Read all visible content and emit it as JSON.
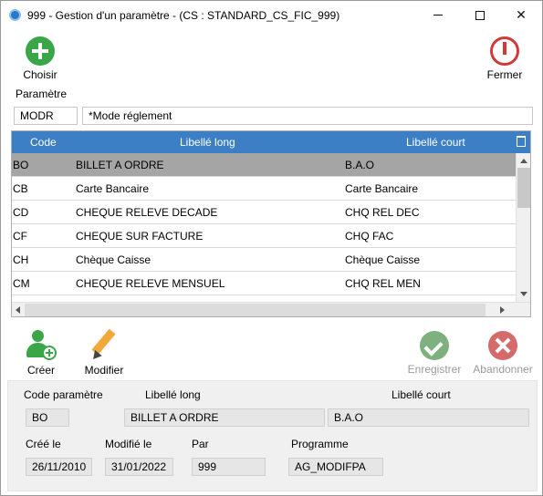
{
  "window": {
    "title": "999 - Gestion d'un paramètre - (CS : STANDARD_CS_FIC_999)",
    "controls": {
      "minimize": "—",
      "maximize": "☐",
      "close": "✕"
    }
  },
  "toolbar": {
    "choose_label": "Choisir",
    "close_label": "Fermer"
  },
  "parameter": {
    "section_label": "Paramètre",
    "code": "MODR",
    "label": "*Mode réglement"
  },
  "grid": {
    "columns": [
      "Code",
      "Libellé long",
      "Libellé court"
    ],
    "rows": [
      {
        "code": "BO",
        "long": "BILLET A ORDRE",
        "short": "B.A.O"
      },
      {
        "code": "CB",
        "long": "Carte Bancaire",
        "short": "Carte Bancaire"
      },
      {
        "code": "CD",
        "long": "CHEQUE RELEVE DECADE",
        "short": "CHQ REL DEC"
      },
      {
        "code": "CF",
        "long": "CHEQUE SUR FACTURE",
        "short": "CHQ FAC"
      },
      {
        "code": "CH",
        "long": "Chèque Caisse",
        "short": "Chèque Caisse"
      },
      {
        "code": "CM",
        "long": "CHEQUE RELEVE MENSUEL",
        "short": "CHQ REL MEN"
      }
    ],
    "selected_index": 0
  },
  "actions": {
    "create_label": "Créer",
    "modify_label": "Modifier",
    "save_label": "Enregistrer",
    "cancel_label": "Abandonner"
  },
  "detail": {
    "code_label": "Code paramètre",
    "long_label": "Libellé long",
    "short_label": "Libellé court",
    "code_value": "BO",
    "long_value": "BILLET A ORDRE",
    "short_value": "B.A.O",
    "created_label": "Créé le",
    "modified_label": "Modifié le",
    "by_label": "Par",
    "program_label": "Programme",
    "created_value": "26/11/2010",
    "modified_value": "31/01/2022",
    "by_value": "999",
    "program_value": "AG_MODIFPA"
  },
  "colors": {
    "accent_header": "#3c7fc4",
    "selection": "#a5a5a5",
    "green": "#3aa648",
    "red": "#d23a3a"
  }
}
